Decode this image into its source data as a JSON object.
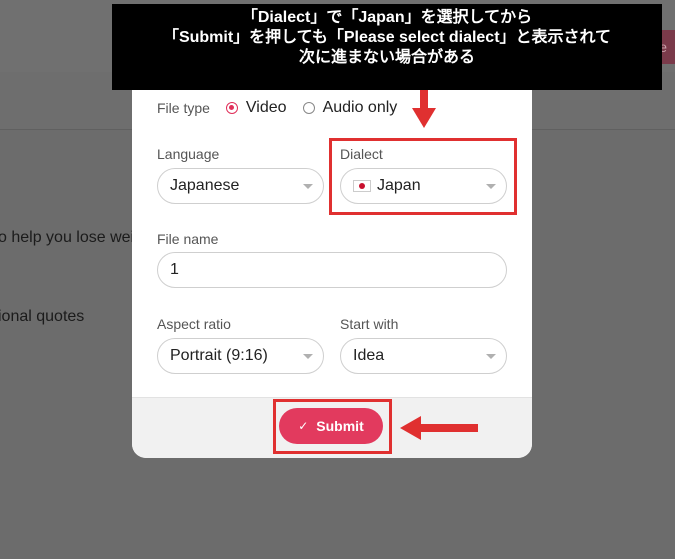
{
  "background": {
    "button_text": "ile",
    "text1": "o help you lose wei",
    "text2": "ional quotes"
  },
  "modal": {
    "file_type_label": "File type",
    "file_type_options": [
      "Video",
      "Audio only"
    ],
    "language_label": "Language",
    "language_value": "Japanese",
    "dialect_label": "Dialect",
    "dialect_value": "Japan",
    "file_name_label": "File name",
    "file_name_value": "1",
    "aspect_ratio_label": "Aspect ratio",
    "aspect_ratio_value": "Portrait (9:16)",
    "start_with_label": "Start with",
    "start_with_value": "Idea",
    "submit_label": "Submit"
  },
  "annotation": {
    "line1": "「Dialect」で「Japan」を選択してから",
    "line2": "「Submit」を押しても「Please select dialect」と表示されて",
    "line3": "次に進まない場合がある"
  },
  "colors": {
    "accent": "#e23a5e",
    "annotation_red": "#e03030"
  },
  "icons": {
    "dialect_flag": "japan-flag-icon",
    "submit_icon": "check-icon",
    "select_caret": "chevron-down-icon"
  }
}
